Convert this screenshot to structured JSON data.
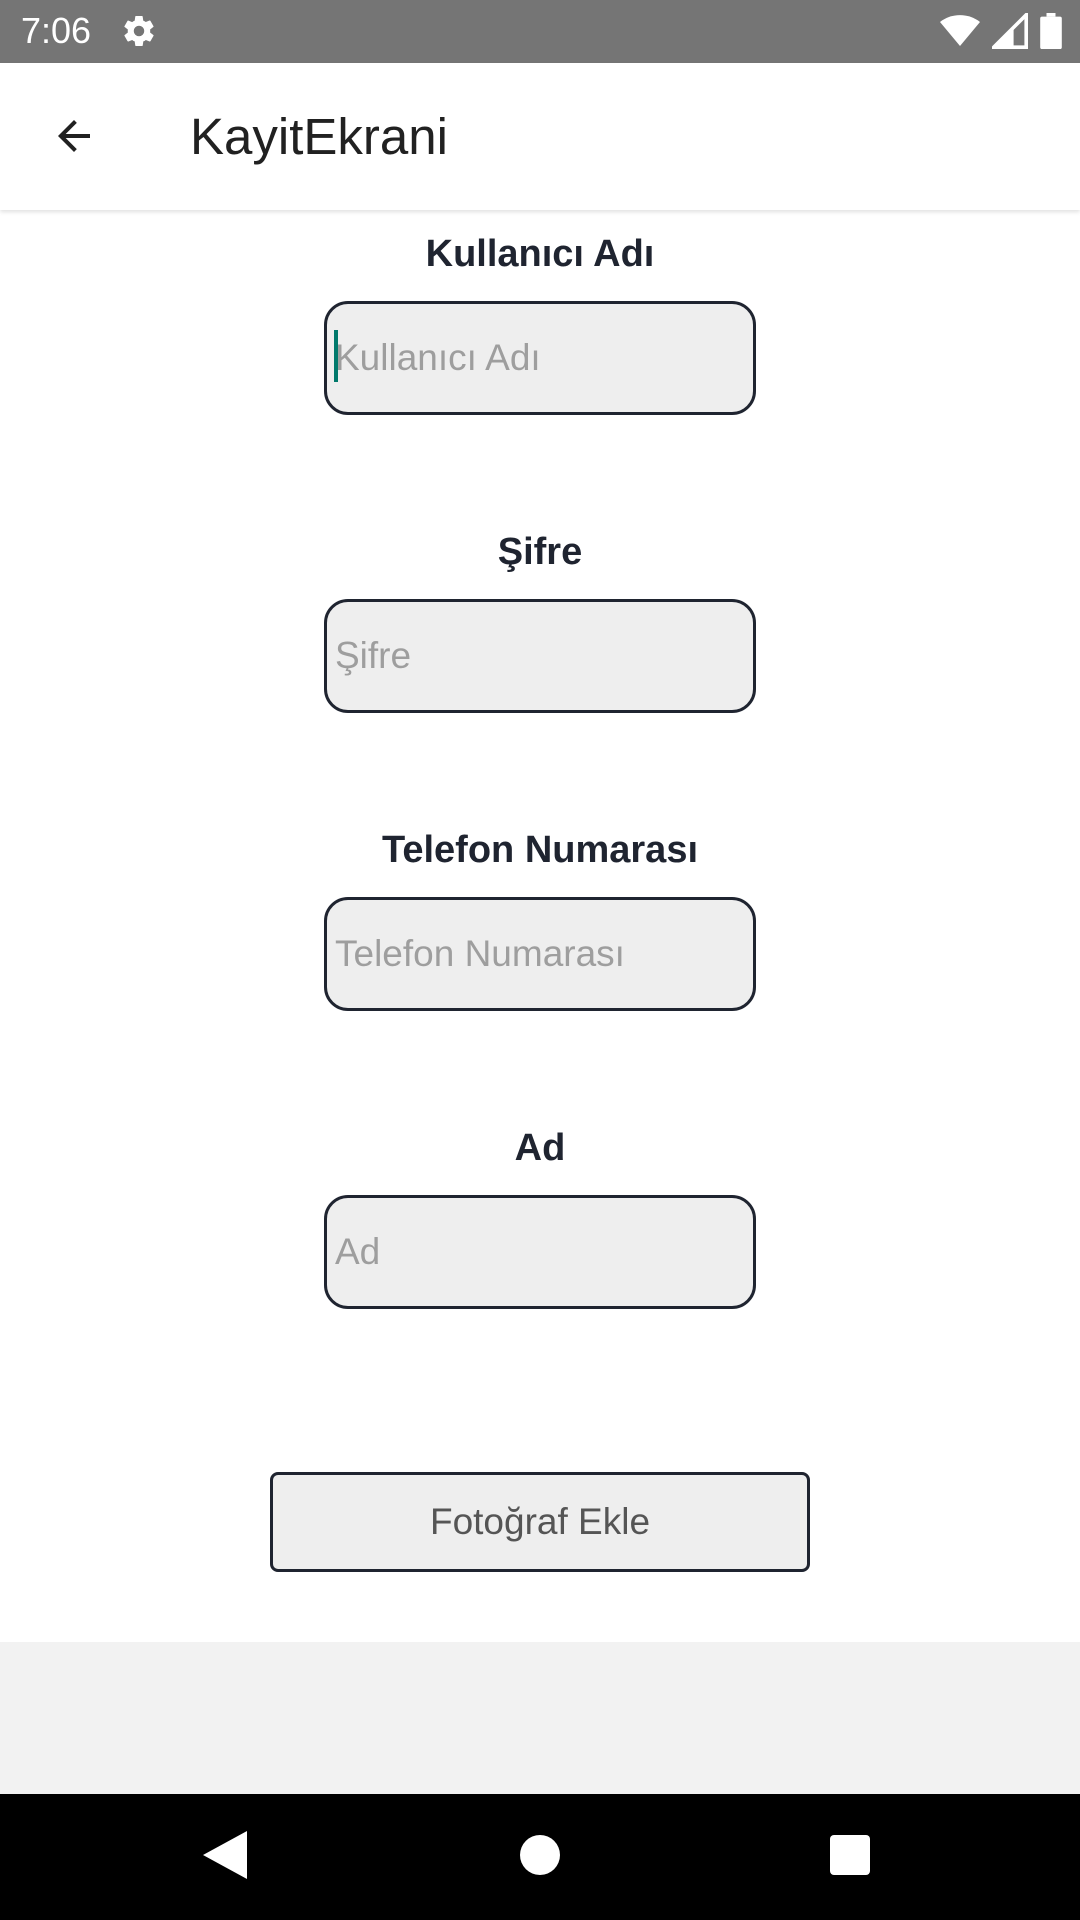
{
  "status_bar": {
    "time": "7:06",
    "icons": [
      "gear-icon",
      "wifi-icon",
      "signal-icon",
      "battery-icon"
    ]
  },
  "app_bar": {
    "title": "KayitEkrani",
    "back_icon": "arrow-back-icon"
  },
  "form": {
    "fields": [
      {
        "label": "Kullanıcı Adı",
        "placeholder": "Kullanıcı Adı",
        "value": ""
      },
      {
        "label": "Şifre",
        "placeholder": "Şifre",
        "value": ""
      },
      {
        "label": "Telefon Numarası",
        "placeholder": "Telefon Numarası",
        "value": ""
      },
      {
        "label": "Ad",
        "placeholder": "Ad",
        "value": ""
      }
    ],
    "photo_button_label": "Fotoğraf Ekle"
  },
  "nav_bar": {
    "buttons": [
      "back-triangle-icon",
      "home-circle-icon",
      "recents-square-icon"
    ]
  },
  "colors": {
    "status_bar_bg": "#757575",
    "input_bg": "#eeeeee",
    "input_border": "#1f2430",
    "cursor": "#00796b"
  }
}
